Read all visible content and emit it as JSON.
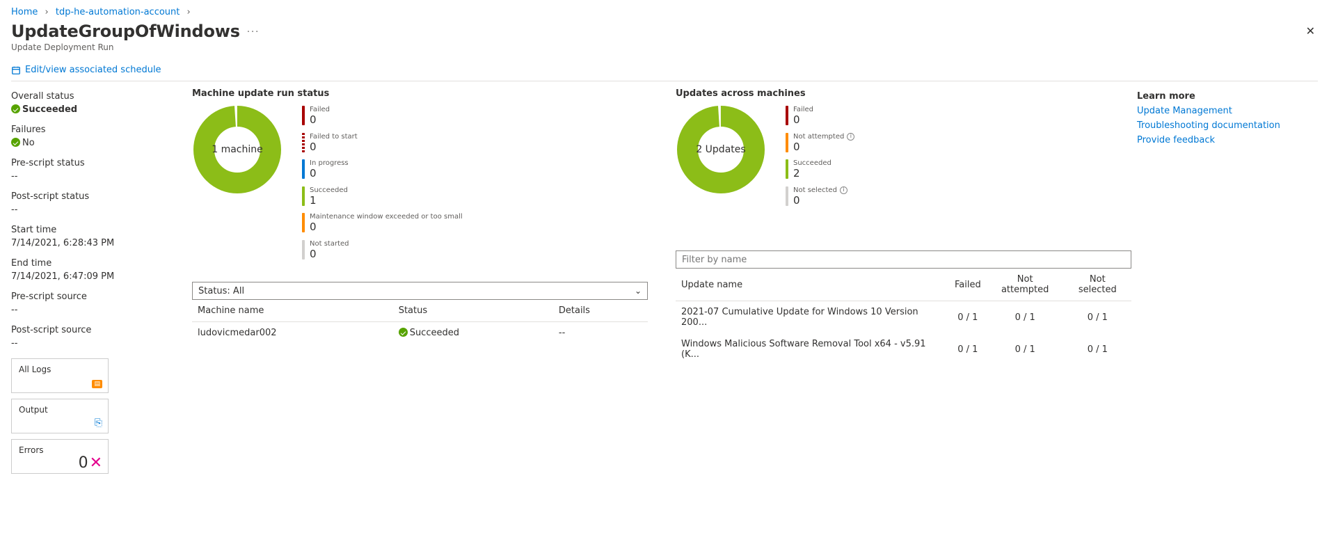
{
  "breadcrumb": {
    "home": "Home",
    "acct": "tdp-he-automation-account"
  },
  "title": "UpdateGroupOfWindows",
  "subtitle": "Update Deployment Run",
  "toolbar": {
    "edit": "Edit/view associated schedule"
  },
  "sidebar": {
    "overall_label": "Overall status",
    "overall_val": "Succeeded",
    "failures_label": "Failures",
    "failures_val": "No",
    "pre_label": "Pre-script status",
    "pre_val": "--",
    "post_label": "Post-script status",
    "post_val": "--",
    "start_label": "Start time",
    "start_val": "7/14/2021, 6:28:43 PM",
    "end_label": "End time",
    "end_val": "7/14/2021, 6:47:09 PM",
    "presrc_label": "Pre-script source",
    "presrc_val": "--",
    "postsrc_label": "Post-script source",
    "postsrc_val": "--",
    "tiles": {
      "all_logs": "All Logs",
      "output": "Output",
      "errors": "Errors",
      "errors_n": "0"
    }
  },
  "machine": {
    "title": "Machine update run status",
    "center": "1 machine",
    "stats": [
      {
        "name": "Failed",
        "val": "0",
        "color": "#a80000"
      },
      {
        "name": "Failed to start",
        "val": "0",
        "color": "#a80000",
        "dashed": true
      },
      {
        "name": "In progress",
        "val": "0",
        "color": "#0078d4"
      },
      {
        "name": "Succeeded",
        "val": "1",
        "color": "#8cbd18"
      },
      {
        "name": "Maintenance window exceeded or too small",
        "val": "0",
        "color": "#ff8c00"
      },
      {
        "name": "Not started",
        "val": "0",
        "color": "#d2d0ce"
      }
    ]
  },
  "updates": {
    "title": "Updates across machines",
    "center": "2 Updates",
    "stats": [
      {
        "name": "Failed",
        "val": "0",
        "color": "#a80000"
      },
      {
        "name": "Not attempted",
        "val": "0",
        "color": "#ff8c00",
        "info": true
      },
      {
        "name": "Succeeded",
        "val": "2",
        "color": "#8cbd18"
      },
      {
        "name": "Not selected",
        "val": "0",
        "color": "#d2d0ce",
        "info": true
      }
    ]
  },
  "learn": {
    "title": "Learn more",
    "l1": "Update Management",
    "l2": "Troubleshooting documentation",
    "l3": "Provide feedback"
  },
  "filters": {
    "status": "Status: All",
    "name_ph": "Filter by name"
  },
  "machines_tbl": {
    "h": {
      "name": "Machine name",
      "status": "Status",
      "details": "Details"
    },
    "r": {
      "name": "ludovicmedar002",
      "status": "Succeeded",
      "details": "--"
    }
  },
  "updates_tbl": {
    "h": {
      "name": "Update name",
      "failed": "Failed",
      "na": "Not attempted",
      "ns": "Not selected"
    },
    "r1": {
      "name": "2021-07 Cumulative Update for Windows 10 Version 200...",
      "f": "0 / 1",
      "na": "0 / 1",
      "ns": "0 / 1"
    },
    "r2": {
      "name": "Windows Malicious Software Removal Tool x64 - v5.91 (K...",
      "f": "0 / 1",
      "na": "0 / 1",
      "ns": "0 / 1"
    }
  },
  "chart_data": [
    {
      "type": "pie",
      "title": "Machine update run status",
      "series": [
        {
          "name": "Succeeded",
          "value": 1
        }
      ],
      "total_label": "1 machine"
    },
    {
      "type": "pie",
      "title": "Updates across machines",
      "series": [
        {
          "name": "Succeeded",
          "value": 2
        }
      ],
      "total_label": "2 Updates"
    }
  ]
}
